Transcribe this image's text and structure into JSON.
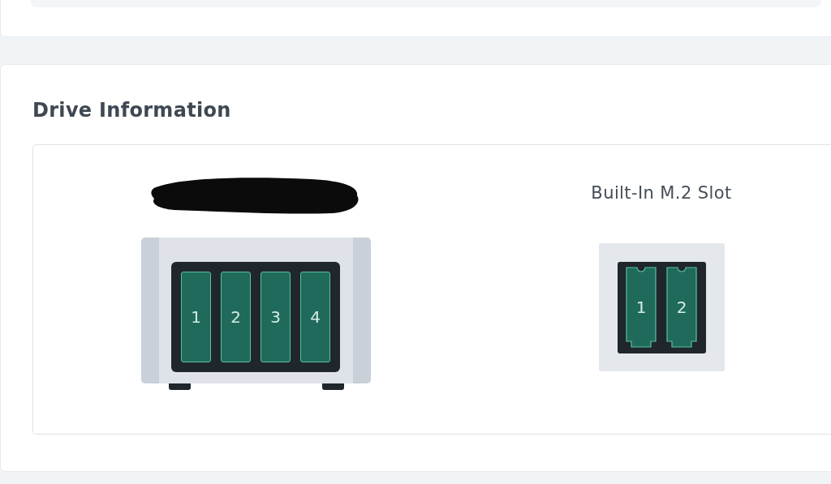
{
  "section": {
    "title": "Drive Information"
  },
  "devices": [
    {
      "kind": "nas",
      "redacted": true,
      "bays": [
        "1",
        "2",
        "3",
        "4"
      ]
    },
    {
      "kind": "m2",
      "title": "Built-In M.2 Slot",
      "slots": [
        "1",
        "2"
      ]
    }
  ]
}
